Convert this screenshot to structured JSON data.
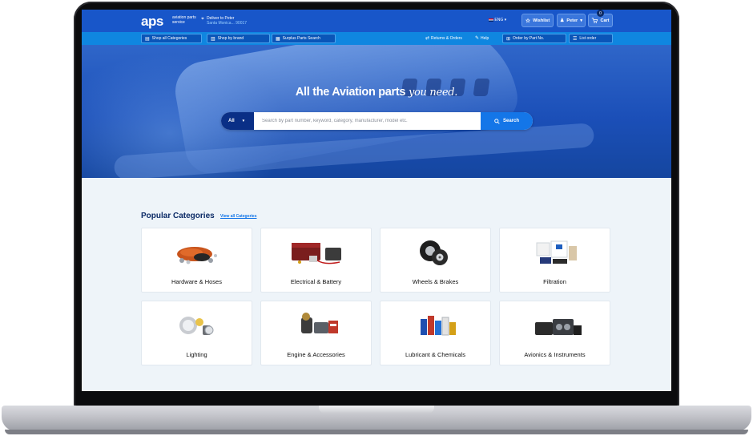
{
  "header": {
    "logo": "aps",
    "logo_tagline": "aviation parts service",
    "deliver_to": "Deliver to Peter",
    "deliver_location": "Santa Monica... 90017",
    "language": "ENG",
    "wishlist_label": "Wishlist",
    "user_label": "Peter",
    "cart_label": "Cart",
    "cart_count": "0"
  },
  "nav": {
    "shop_all": "Shop all Categories",
    "shop_brand": "Shop by brand",
    "surplus": "Surplus Parts Search",
    "returns": "Returns & Orders",
    "help": "Help",
    "order_part": "Order by Part No.",
    "list_order": "List order"
  },
  "hero": {
    "title_main": "All the Aviation parts",
    "title_script": "you need.",
    "search_category": "All",
    "search_placeholder": "Search by part number, keyword, category, manufacturer, model etc.",
    "search_button": "Search"
  },
  "categories": {
    "title": "Popular Categories",
    "view_all": "View all Categories",
    "items": [
      {
        "label": "Hardware & Hoses",
        "icon": "hoses-icon"
      },
      {
        "label": "Electrical & Battery",
        "icon": "battery-icon"
      },
      {
        "label": "Wheels & Brakes",
        "icon": "wheel-icon"
      },
      {
        "label": "Filtration",
        "icon": "filter-icon"
      },
      {
        "label": "Lighting",
        "icon": "light-icon"
      },
      {
        "label": "Engine & Accessories",
        "icon": "engine-icon"
      },
      {
        "label": "Lubricant & Chemicals",
        "icon": "chemicals-icon"
      },
      {
        "label": "Avionics & Instruments",
        "icon": "avionics-icon"
      }
    ]
  },
  "colors": {
    "brand_blue": "#1856c9",
    "nav_blue": "#0f86e0",
    "dark_navy": "#0b2a66",
    "accent": "#1476e8"
  }
}
